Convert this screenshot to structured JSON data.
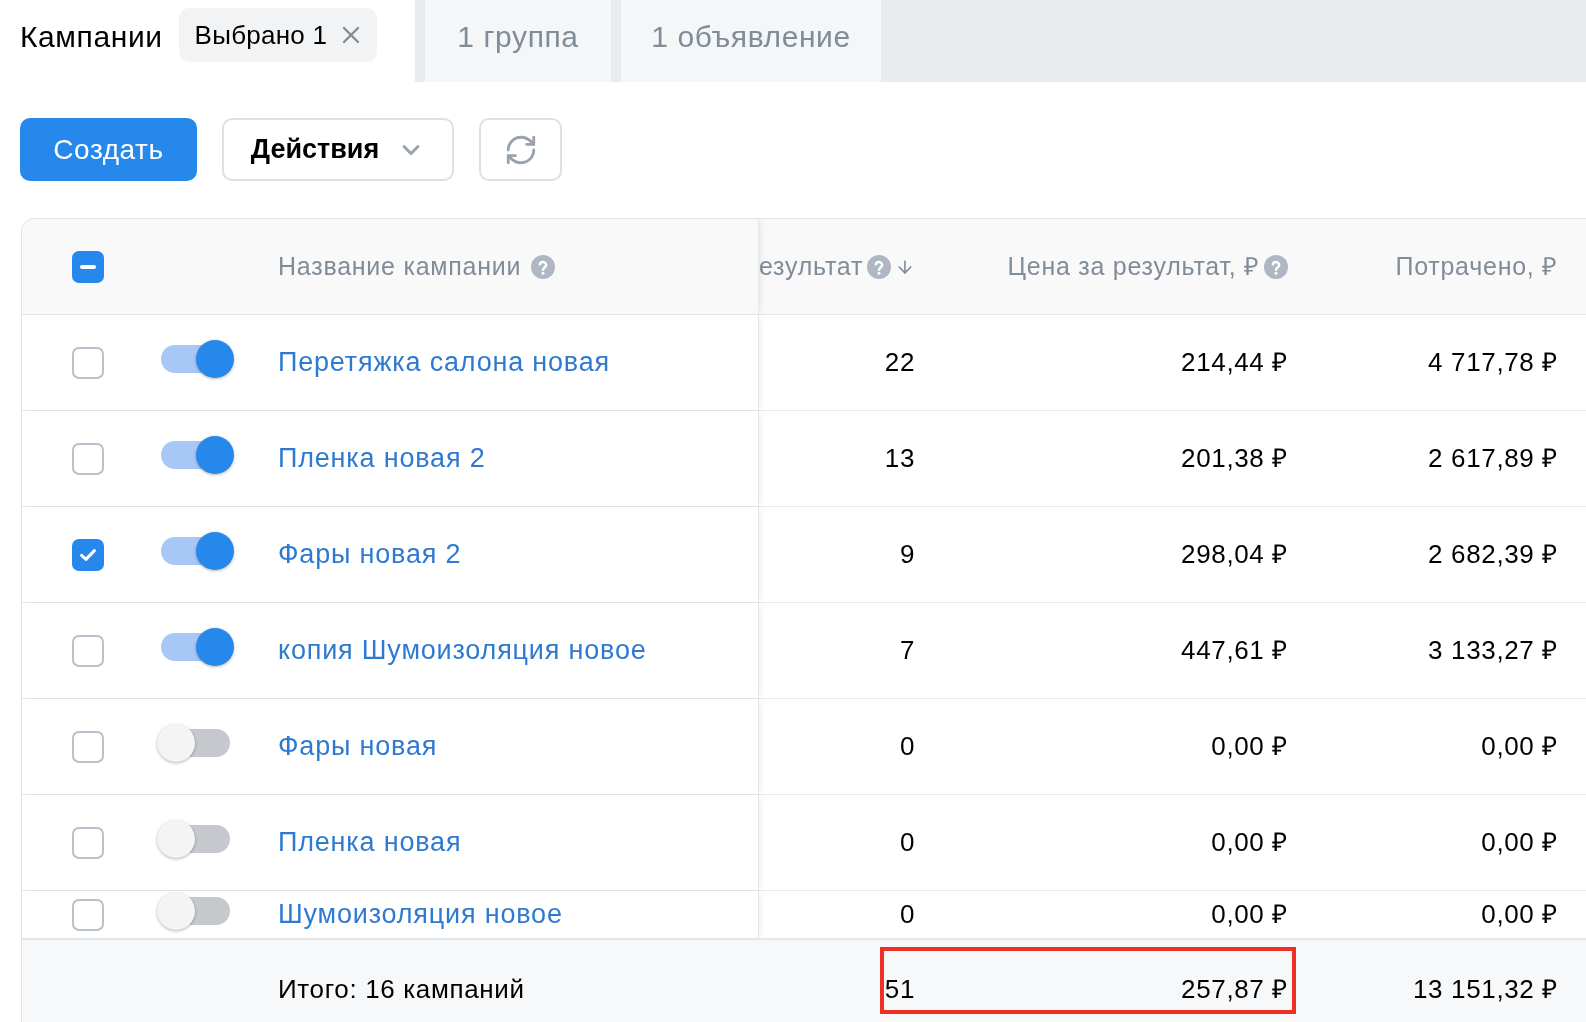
{
  "tabs": [
    {
      "label": "Кампании",
      "selected": true,
      "chip": "Выбрано 1"
    },
    {
      "label": "1 группа",
      "selected": false
    },
    {
      "label": "1 объявление",
      "selected": false
    }
  ],
  "toolbar": {
    "create_button": "Создать",
    "actions_button": "Действия"
  },
  "table": {
    "select_all": {
      "checked": true,
      "partial": true
    },
    "columns": [
      {
        "label": "Название кампании",
        "help": true
      },
      {
        "label": "езультат",
        "help": true,
        "sorted": true
      },
      {
        "label": "Цена за результат, ₽",
        "help": true
      },
      {
        "label": "Потрачено, ₽",
        "help": false
      }
    ],
    "rows": [
      {
        "checked": false,
        "enabled": true,
        "cells": [
          "Перетяжка салона новая",
          "22",
          "214,44 ₽",
          "4 717,78 ₽"
        ]
      },
      {
        "checked": false,
        "enabled": true,
        "cells": [
          "Пленка новая 2",
          "13",
          "201,38 ₽",
          "2 617,89 ₽"
        ]
      },
      {
        "checked": true,
        "enabled": true,
        "cells": [
          "Фары новая 2",
          "9",
          "298,04 ₽",
          "2 682,39 ₽"
        ]
      },
      {
        "checked": false,
        "enabled": true,
        "cells": [
          "копия Шумоизоляция новое",
          "7",
          "447,61 ₽",
          "3 133,27 ₽"
        ]
      },
      {
        "checked": false,
        "enabled": false,
        "cells": [
          "Фары новая",
          "0",
          "0,00 ₽",
          "0,00 ₽"
        ]
      },
      {
        "checked": false,
        "enabled": false,
        "cells": [
          "Пленка новая",
          "0",
          "0,00 ₽",
          "0,00 ₽"
        ]
      },
      {
        "checked": false,
        "enabled": false,
        "cells": [
          "Шумоизоляция новое",
          "0",
          "0,00 ₽",
          "0,00 ₽"
        ]
      }
    ],
    "footer": {
      "cells": [
        "Итого: 16 кампаний",
        "51",
        "257,87 ₽",
        "13 151,32 ₽"
      ],
      "highlighted": true
    }
  }
}
